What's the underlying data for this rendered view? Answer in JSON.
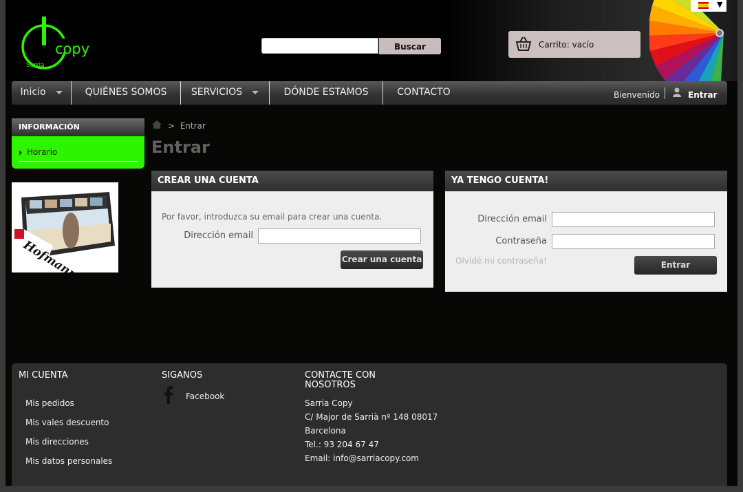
{
  "header": {
    "logo_text": "copy",
    "logo_sub": "Sarria",
    "search": {
      "value": "",
      "button_label": "Buscar"
    },
    "cart_label": "Carrito: vacío",
    "language": "ES"
  },
  "nav": {
    "items": [
      {
        "label": "Inicio",
        "has_menu": true
      },
      {
        "label": "QUIÉNES SOMOS",
        "has_menu": false
      },
      {
        "label": "SERVICIOS",
        "has_menu": true
      },
      {
        "label": "DÓNDE ESTAMOS",
        "has_menu": false
      },
      {
        "label": "CONTACTO",
        "has_menu": false
      }
    ],
    "welcome": "Bienvenido",
    "login": "Entrar"
  },
  "sidebar": {
    "title": "INFORMACIÓN",
    "items": [
      {
        "label": "Horario"
      }
    ],
    "banner_text": "Hofmann"
  },
  "breadcrumb": {
    "separator": ">",
    "current": "Entrar"
  },
  "page_title": "Entrar",
  "create_account": {
    "title": "CREAR UNA CUENTA",
    "intro": "Por favor, introduzca su email para crear una cuenta.",
    "email_label": "Dirección email",
    "email_value": "",
    "button": "Crear una cuenta"
  },
  "login": {
    "title": "YA TENGO CUENTA!",
    "email_label": "Dirección email",
    "password_label": "Contraseña",
    "forgot": "Olvidé mi contraseña!",
    "button": "Entrar"
  },
  "footer": {
    "account": {
      "title": "MI CUENTA",
      "links": [
        "Mis pedidos",
        "Mis vales descuento",
        "Mis direcciones",
        "Mis datos personales"
      ]
    },
    "follow": {
      "title": "SIGANOS",
      "facebook": "Facebook"
    },
    "contact": {
      "title_line1": "CONTACTE CON",
      "title_line2": "NOSOTROS",
      "lines": [
        "Sarria Copy",
        "C/ Major de Sarrià nº 148 08017",
        "Barcelona",
        "Tel.: 93 204 67 47",
        "Email: info@sarriacopy.com"
      ]
    }
  },
  "colors": {
    "accent_green": "#2df500",
    "background": "#070806",
    "panel": "#eeeeee"
  }
}
